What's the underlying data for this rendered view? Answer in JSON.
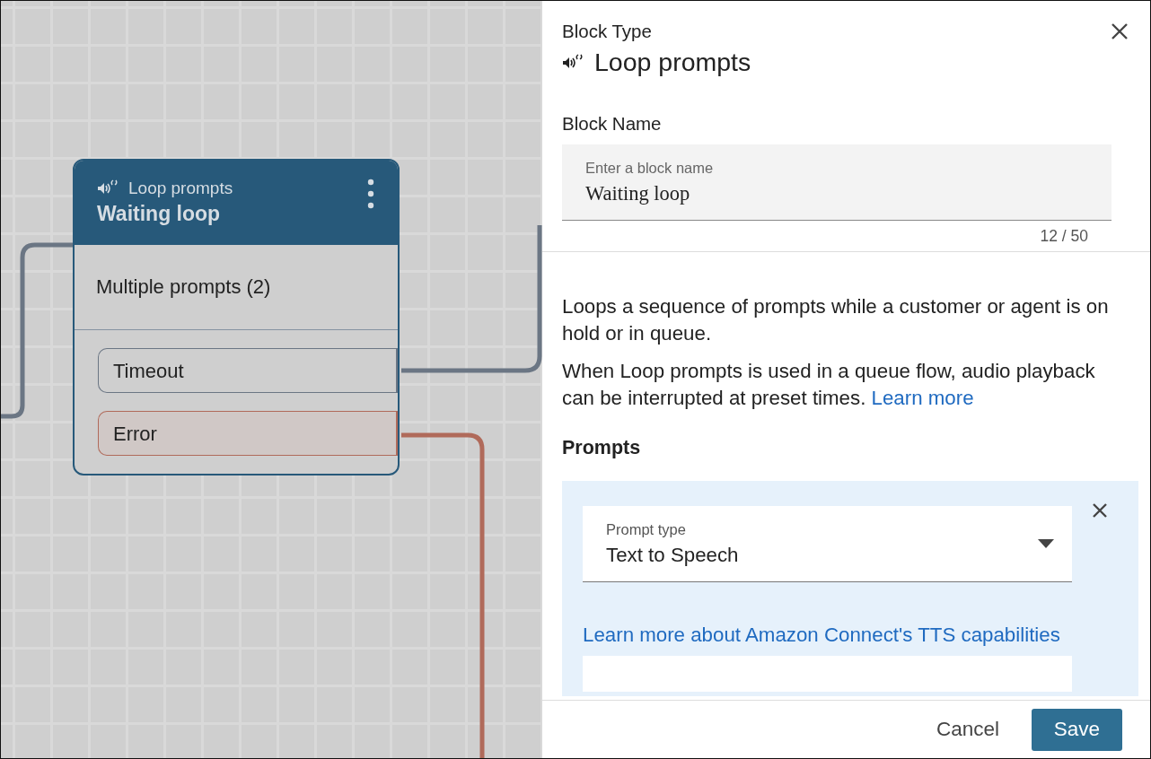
{
  "canvas": {
    "node": {
      "type_label": "Loop prompts",
      "name": "Waiting loop",
      "summary": "Multiple prompts (2)",
      "branches": [
        {
          "label": "Timeout",
          "kind": "default"
        },
        {
          "label": "Error",
          "kind": "error"
        }
      ]
    }
  },
  "panel": {
    "type_heading": "Block Type",
    "type_name": "Loop prompts",
    "name_label": "Block Name",
    "name_field": {
      "label": "Enter a block name",
      "value": "Waiting loop",
      "counter": "12 / 50"
    },
    "description": [
      "Loops a sequence of prompts while a customer or agent is on hold or in queue.",
      "When Loop prompts is used in a queue flow, audio playback can be interrupted at preset times."
    ],
    "learn_more": "Learn more",
    "prompts_heading": "Prompts",
    "prompts": [
      {
        "type_label": "Prompt type",
        "type_value": "Text to Speech",
        "help_link": "Learn more about Amazon Connect's TTS capabilities"
      }
    ],
    "buttons": [
      {
        "label": "Cancel",
        "kind": "secondary"
      },
      {
        "label": "Save",
        "kind": "primary"
      }
    ]
  }
}
